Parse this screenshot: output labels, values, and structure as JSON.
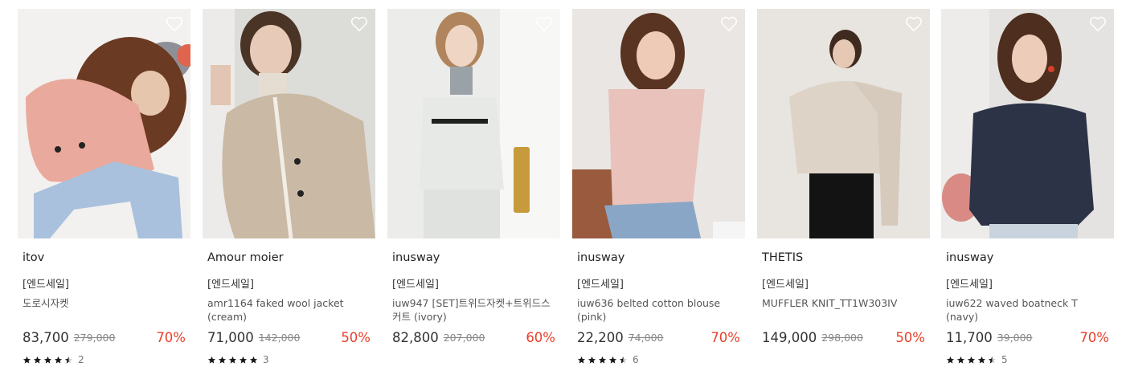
{
  "products": [
    {
      "brand": "itov",
      "tag": "[엔드세일]",
      "name": "도로시자켓",
      "price": "83,700",
      "original_price": "279,000",
      "discount": "70%",
      "rating": 4.5,
      "review_count": "2",
      "colors": {
        "bg": "#ece9e6",
        "garment": "#e9a99c",
        "hair": "#6b3a22"
      }
    },
    {
      "brand": "Amour moier",
      "tag": "[엔드세일]",
      "name": "amr1164 faked wool jacket (cream)",
      "price": "71,000",
      "original_price": "142,000",
      "discount": "50%",
      "rating": 5,
      "review_count": "3",
      "colors": {
        "bg": "#dcdcd9",
        "garment": "#c9b9a5",
        "hair": "#4a3426"
      }
    },
    {
      "brand": "inusway",
      "tag": "[엔드세일]",
      "name": "iuw947 [SET]트위드자켓+트위드스커트 (ivory)",
      "price": "82,800",
      "original_price": "207,000",
      "discount": "60%",
      "rating": null,
      "review_count": "",
      "colors": {
        "bg": "#ececea",
        "garment": "#e7e9e6",
        "hair": "#b0845c"
      }
    },
    {
      "brand": "inusway",
      "tag": "[엔드세일]",
      "name": "iuw636 belted cotton blouse (pink)",
      "price": "22,200",
      "original_price": "74,000",
      "discount": "70%",
      "rating": 4.5,
      "review_count": "6",
      "colors": {
        "bg": "#e9e6e3",
        "garment": "#e8c2bb",
        "hair": "#5a3422"
      }
    },
    {
      "brand": "THETIS",
      "tag": "[엔드세일]",
      "name": "MUFFLER KNIT_TT1W303IV",
      "price": "149,000",
      "original_price": "298,000",
      "discount": "50%",
      "rating": null,
      "review_count": "",
      "colors": {
        "bg": "#e8e4df",
        "garment": "#ddd3c6",
        "hair": "#3e2a1e"
      }
    },
    {
      "brand": "inusway",
      "tag": "[엔드세일]",
      "name": "iuw622 waved boatneck T (navy)",
      "price": "11,700",
      "original_price": "39,000",
      "discount": "70%",
      "rating": 4.5,
      "review_count": "5",
      "colors": {
        "bg": "#e5e3e1",
        "garment": "#2c3346",
        "hair": "#4e2e1e"
      }
    }
  ],
  "icons": {
    "wishlist": "heart-outline-icon",
    "rating": "star-icon"
  }
}
